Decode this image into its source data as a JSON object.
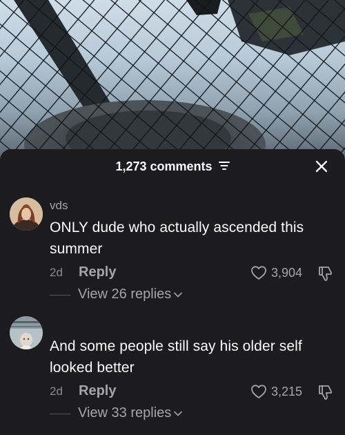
{
  "header": {
    "comment_count": "1,273 comments"
  },
  "icons": {
    "sort": "sort-icon",
    "close": "close-icon",
    "heart": "heart-icon",
    "dislike": "dislike-icon",
    "chevron": "chevron-down-icon"
  },
  "colors": {
    "sheet_bg": "#1c1c1e",
    "primary_text": "#ffffff",
    "secondary_text": "#a5a5aa"
  },
  "comments": [
    {
      "author": "vds",
      "text": "ONLY dude who actually ascended this summer",
      "time": "2d",
      "reply_label": "Reply",
      "likes": "3,904",
      "view_replies": "View 26 replies"
    },
    {
      "author": "",
      "text": "And some people still say his older self looked better",
      "time": "2d",
      "reply_label": "Reply",
      "likes": "3,215",
      "view_replies": "View 33 replies"
    }
  ]
}
